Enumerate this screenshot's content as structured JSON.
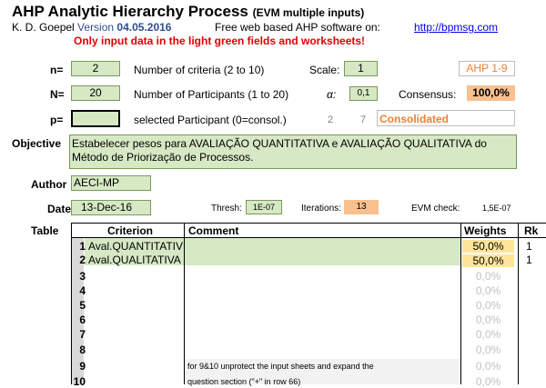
{
  "header": {
    "title": "AHP Analytic Hierarchy Process",
    "title_suffix": "(EVM multiple inputs)",
    "author_line": "K. D. Goepel",
    "version_label": "Version",
    "version_date": "04.05.2016",
    "web_text": "Free web based AHP software on:",
    "web_link": "http://bpmsg.com",
    "warning": "Only input data in the light green fields and worksheets!"
  },
  "params": {
    "n_label": "n=",
    "n_value": "2",
    "n_desc": "Number of criteria (2 to 10)",
    "scale_label": "Scale:",
    "scale_value": "1",
    "scale_name": "AHP 1-9",
    "N_label": "N=",
    "N_value": "20",
    "N_desc": "Number of Participants (1 to 20)",
    "alpha_label": "α:",
    "alpha_value": "0,1",
    "consensus_label": "Consensus:",
    "consensus_value": "100,0%",
    "p_label": "p=",
    "p_value": "",
    "p_desc": "selected Participant (0=consol.)",
    "p_num1": "2",
    "p_num2": "7",
    "p_status": "Consolidated"
  },
  "objective": {
    "label": "Objective",
    "text": "Estabelecer pesos para AVALIAÇÃO QUANTITATIVA e AVALIAÇÃO QUALITATIVA do Método de Priorização de Processos."
  },
  "author": {
    "label": "Author",
    "value": "AECI-MP"
  },
  "date": {
    "label": "Date",
    "value": "13-Dec-16",
    "thresh_label": "Thresh:",
    "thresh_value": "1E-07",
    "iter_label": "Iterations:",
    "iter_value": "13",
    "evm_label": "EVM check:",
    "evm_value": "1,5E-07"
  },
  "table": {
    "label": "Table",
    "headers": {
      "criterion": "Criterion",
      "comment": "Comment",
      "weights": "Weights",
      "rk": "Rk"
    },
    "rows": [
      {
        "num": "1",
        "criterion": "Aval.QUANTITATIV",
        "weight": "50,0%",
        "rk": "1"
      },
      {
        "num": "2",
        "criterion": "Aval.QUALITATIVA",
        "weight": "50,0%",
        "rk": "1"
      },
      {
        "num": "3",
        "criterion": "",
        "weight": "0,0%",
        "rk": ""
      },
      {
        "num": "4",
        "criterion": "",
        "weight": "0,0%",
        "rk": ""
      },
      {
        "num": "5",
        "criterion": "",
        "weight": "0,0%",
        "rk": ""
      },
      {
        "num": "6",
        "criterion": "",
        "weight": "0,0%",
        "rk": ""
      },
      {
        "num": "7",
        "criterion": "",
        "weight": "0,0%",
        "rk": ""
      },
      {
        "num": "8",
        "criterion": "",
        "weight": "0,0%",
        "rk": ""
      },
      {
        "num": "9",
        "criterion": "",
        "weight": "0,0%",
        "rk": ""
      },
      {
        "num": "10",
        "criterion": "",
        "weight": "0,0%",
        "rk": ""
      }
    ],
    "note_line1": "for 9&10 unprotect the input sheets and expand the",
    "note_line2": "question section (\"+\" in row 66)"
  }
}
